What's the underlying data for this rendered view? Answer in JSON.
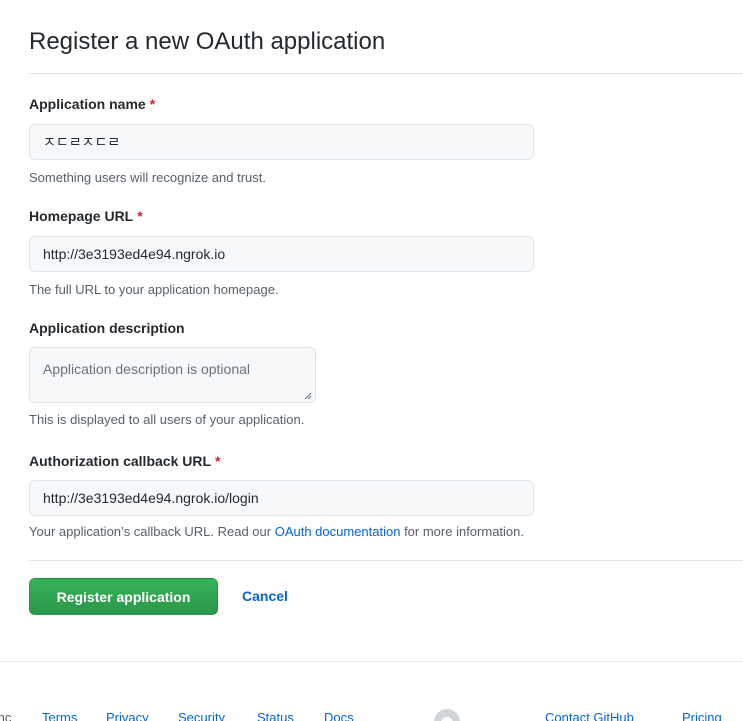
{
  "header": {
    "title": "Register a new OAuth application"
  },
  "form": {
    "app_name": {
      "label": "Application name",
      "required_mark": "*",
      "value": "ㅈㄷㄹㅈㄷㄹ",
      "note": "Something users will recognize and trust."
    },
    "homepage_url": {
      "label": "Homepage URL",
      "required_mark": "*",
      "value": "http://3e3193ed4e94.ngrok.io",
      "note": "The full URL to your application homepage."
    },
    "description": {
      "label": "Application description",
      "placeholder": "Application description is optional",
      "note": "This is displayed to all users of your application."
    },
    "callback_url": {
      "label": "Authorization callback URL",
      "required_mark": "*",
      "value": "http://3e3193ed4e94.ngrok.io/login",
      "note_prefix": "Your application’s callback URL. Read our ",
      "note_link": "OAuth documentation",
      "note_suffix": " for more information."
    }
  },
  "actions": {
    "submit_label": "Register application",
    "cancel_label": "Cancel"
  },
  "footer": {
    "left_fragment": "Inc",
    "links": [
      "Terms",
      "Privacy",
      "Security",
      "Status",
      "Docs",
      "Contact GitHub",
      "Pricing"
    ],
    "logo_icon": "github-mark-icon"
  },
  "colors": {
    "primary_button": "#2ea44f",
    "link": "#0366d6",
    "required": "#cb2431"
  }
}
